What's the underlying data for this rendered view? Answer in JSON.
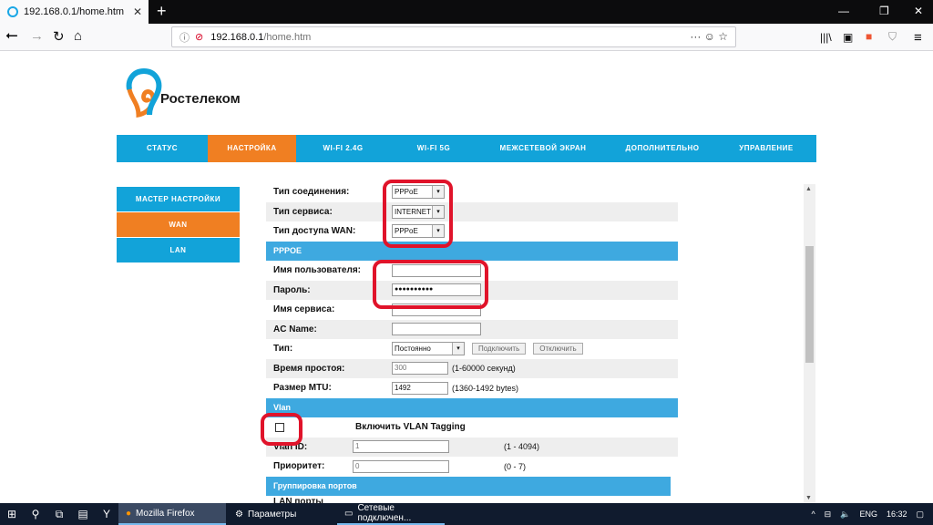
{
  "browser": {
    "tab_title": "192.168.0.1/home.htm",
    "url_host": "192.168.0.1",
    "url_path": "/home.htm",
    "url_actions": "··· ☺ ☆"
  },
  "brand": {
    "name": "Ростелеком"
  },
  "main_nav": [
    {
      "label": "СТАТУС",
      "active": false
    },
    {
      "label": "НАСТРОЙКА",
      "active": true
    },
    {
      "label": "WI-FI 2.4G",
      "active": false
    },
    {
      "label": "WI-FI 5G",
      "active": false
    },
    {
      "label": "МЕЖСЕТЕВОЙ ЭКРАН",
      "active": false
    },
    {
      "label": "ДОПОЛНИТЕЛЬНО",
      "active": false
    },
    {
      "label": "УПРАВЛЕНИЕ",
      "active": false
    }
  ],
  "side_nav": [
    {
      "label": "МАСТЕР НАСТРОЙКИ",
      "active": false
    },
    {
      "label": "WAN",
      "active": true
    },
    {
      "label": "LAN",
      "active": false
    }
  ],
  "form": {
    "connection_type_label": "Тип соединения:",
    "connection_type_value": "PPPoE",
    "service_type_label": "Тип сервиса:",
    "service_type_value": "INTERNET",
    "wan_access_label": "Тип доступа WAN:",
    "wan_access_value": "PPPoE",
    "pppoe_section": "PPPOE",
    "username_label": "Имя пользователя:",
    "username_value": "",
    "password_label": "Пароль:",
    "password_value": "●●●●●●●●●●",
    "service_name_label": "Имя сервиса:",
    "ac_name_label": "AC Name:",
    "type_label": "Тип:",
    "type_value": "Постоянно",
    "connect_button": "Подключить",
    "disconnect_button": "Отключить",
    "idle_label": "Время простоя:",
    "idle_value": "300",
    "idle_hint": "(1-60000 секунд)",
    "mtu_label": "Размер MTU:",
    "mtu_value": "1492",
    "mtu_hint": "(1360-1492 bytes)",
    "vlan_section": "Vlan",
    "vlan_enable_label": "Включить VLAN Tagging",
    "vlan_id_label": "Vlan ID:",
    "vlan_id_value": "1",
    "vlan_id_hint": "(1 - 4094)",
    "priority_label": "Приоритет:",
    "priority_value": "0",
    "priority_hint": "(0 - 7)",
    "port_group_section": "Группировка портов",
    "lan_ports_label": "LAN порты"
  },
  "taskbar": {
    "apps": [
      {
        "label": "Mozilla Firefox",
        "active": true
      },
      {
        "label": "Параметры",
        "active": false
      },
      {
        "label": "Сетевые подключен...",
        "active": false
      }
    ],
    "lang": "ENG",
    "time": "16:32"
  },
  "colors": {
    "nav_blue": "#12a3d9",
    "active_orange": "#f07f22",
    "highlight_red": "#e0132a"
  }
}
